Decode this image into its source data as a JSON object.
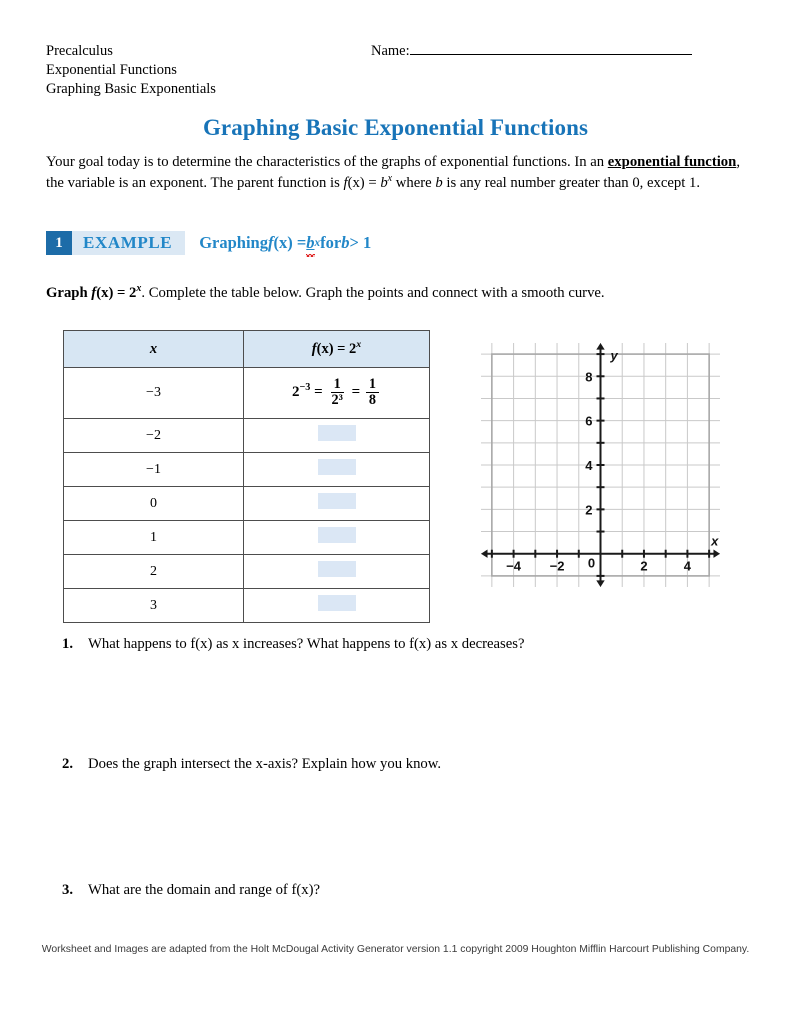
{
  "header": {
    "course": "Precalculus",
    "unit": "Exponential Functions",
    "lesson": "Graphing Basic Exponentials",
    "name_label": "Name:"
  },
  "page_title": "Graphing Basic Exponential Functions",
  "intro": {
    "part1": "Your goal today is to determine the characteristics of the graphs of exponential functions. In an ",
    "emphasis1": "exponential function",
    "part2": ", the variable is an exponent. The parent function is ",
    "formula_f": "f",
    "formula_x": "(x) = ",
    "formula_b": "b",
    "formula_exp": "x",
    "part3": " where ",
    "formula_b2": "b",
    "part4": " is any real number greater than 0, except 1."
  },
  "example": {
    "number": "1",
    "word": "EXAMPLE",
    "title_pre": "Graphing ",
    "title_f": "f",
    "title_eq": "(x) = ",
    "title_b": "b",
    "title_exp": "x",
    "title_post": " for ",
    "title_b2": "b",
    "title_cond": " > 1",
    "badge_color": "#1d6ca8",
    "band_color": "#dbe8f4",
    "text_color": "#2287c8"
  },
  "graph_instruction": {
    "lead_graph": "Graph ",
    "lead_f": "f",
    "lead_fx": "(x) = 2",
    "lead_exp": "x",
    "lead_period": ".",
    "rest": " Complete the table below. Graph the points and connect with a smooth curve."
  },
  "table": {
    "headers": {
      "x": "x",
      "fx_pre": "f",
      "fx_mid": "(x) = 2",
      "fx_exp": "x"
    },
    "rows": [
      {
        "x": "−3",
        "value_type": "expression",
        "expr": {
          "base": "2",
          "base_exp": "−3",
          "eq1": " = ",
          "frac1_num": "1",
          "frac1_den": "2³",
          "eq2": " = ",
          "frac2_num": "1",
          "frac2_den": "8"
        }
      },
      {
        "x": "−2",
        "value_type": "blank"
      },
      {
        "x": "−1",
        "value_type": "blank"
      },
      {
        "x": "0",
        "value_type": "blank"
      },
      {
        "x": "1",
        "value_type": "blank"
      },
      {
        "x": "2",
        "value_type": "blank"
      },
      {
        "x": "3",
        "value_type": "blank"
      }
    ],
    "answer_box_color": "#dbe7f5",
    "header_bg": "#d7e6f3"
  },
  "chart_data": {
    "type": "scatter",
    "title": "",
    "xlabel": "x",
    "ylabel": "y",
    "xlim": [
      -5.5,
      5.5
    ],
    "ylim": [
      -1.5,
      9.5
    ],
    "x_ticks": [
      -4,
      -2,
      0,
      2,
      4
    ],
    "x_tick_labels": [
      "−4",
      "−2",
      "0",
      "2",
      "4"
    ],
    "y_ticks": [
      2,
      4,
      6,
      8
    ],
    "y_tick_labels": [
      "2",
      "4",
      "6",
      "8"
    ],
    "minor_tick_step": 1,
    "grid": true,
    "grid_color": "#c9c9c9",
    "axis_color": "#1a1a1a",
    "legend": "none",
    "series": [],
    "note": "Empty coordinate grid for plotting f(x) = 2^x"
  },
  "questions": [
    {
      "number": "1.",
      "text": "What happens to f(x) as x increases? What happens to f(x) as x decreases?"
    },
    {
      "number": "2.",
      "text": "Does the graph intersect the x-axis? Explain how you know."
    },
    {
      "number": "3.",
      "text": "What are the domain and range of f(x)?"
    }
  ],
  "footer": "Worksheet and Images are adapted from the Holt McDougal Activity Generator version 1.1 copyright 2009 Houghton Mifflin Harcourt Publishing Company."
}
